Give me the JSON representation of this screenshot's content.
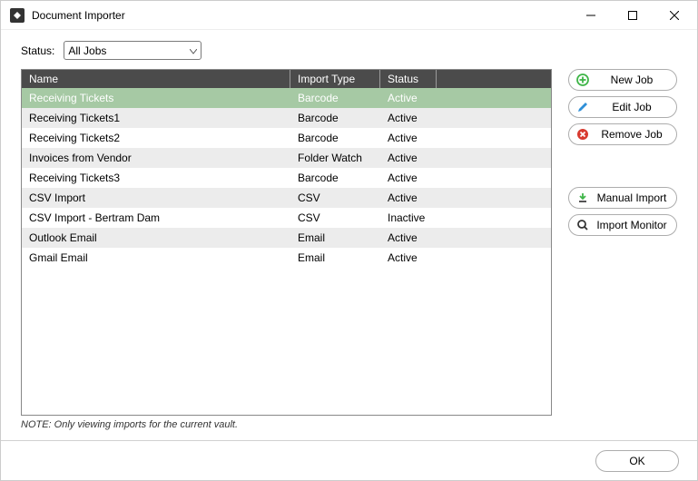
{
  "window": {
    "title": "Document Importer"
  },
  "filter": {
    "label": "Status:",
    "value": "All Jobs"
  },
  "grid": {
    "headers": {
      "name": "Name",
      "type": "Import Type",
      "status": "Status"
    },
    "rows": [
      {
        "name": "Receiving Tickets",
        "type": "Barcode",
        "status": "Active",
        "selected": true
      },
      {
        "name": "Receiving Tickets1",
        "type": "Barcode",
        "status": "Active"
      },
      {
        "name": "Receiving Tickets2",
        "type": "Barcode",
        "status": "Active"
      },
      {
        "name": "Invoices from Vendor",
        "type": "Folder Watch",
        "status": "Active"
      },
      {
        "name": "Receiving Tickets3",
        "type": "Barcode",
        "status": "Active"
      },
      {
        "name": "CSV Import",
        "type": "CSV",
        "status": "Active"
      },
      {
        "name": "CSV Import - Bertram Dam",
        "type": "CSV",
        "status": "Inactive"
      },
      {
        "name": "Outlook Email",
        "type": "Email",
        "status": "Active"
      },
      {
        "name": "Gmail Email",
        "type": "Email",
        "status": "Active"
      }
    ]
  },
  "buttons": {
    "new_job": "New Job",
    "edit_job": "Edit Job",
    "remove_job": "Remove Job",
    "manual_import": "Manual Import",
    "import_monitor": "Import Monitor",
    "ok": "OK"
  },
  "note": "NOTE: Only viewing imports for the current vault.",
  "icons": {
    "new_color": "#3fb548",
    "edit_color": "#2f8fd8",
    "remove_color": "#d83a2f",
    "manual_color": "#3fb548",
    "monitor_color": "#333"
  }
}
